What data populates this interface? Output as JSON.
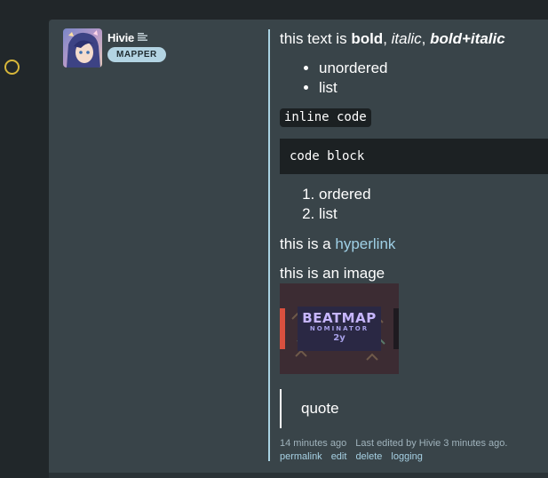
{
  "author": {
    "username": "Hivie",
    "group_badge": "MAPPER",
    "avatar_icon": "anime-avatar",
    "menu_icon": "lines-menu-icon"
  },
  "content": {
    "line1_prefix": "this text is ",
    "line1_bold": "bold",
    "line1_sep1": ", ",
    "line1_italic": "italic",
    "line1_sep2": ", ",
    "line1_bolditalic": "bold+italic",
    "unordered": [
      "unordered",
      "list"
    ],
    "inline_code": "inline code",
    "code_block": "code block",
    "ordered": [
      "ordered",
      "list"
    ],
    "link_prefix": "this is a ",
    "link_text": "hyperlink",
    "image_caption": "this is an image",
    "image": {
      "line1": "BEATMAP",
      "line2": "NOMINATOR",
      "line3": "2y"
    },
    "quote": "quote"
  },
  "meta": {
    "posted": "14 minutes ago",
    "edited_prefix": "Last edited by ",
    "edited_user": "Hivie",
    "edited_suffix": " 3 minutes ago."
  },
  "actions": [
    "permalink",
    "edit",
    "delete",
    "logging"
  ],
  "colors": {
    "status_ring": "#d6b63a",
    "divider": "#a9d2e2",
    "link": "#9fd0e6",
    "badge": "#b3d4e3"
  }
}
